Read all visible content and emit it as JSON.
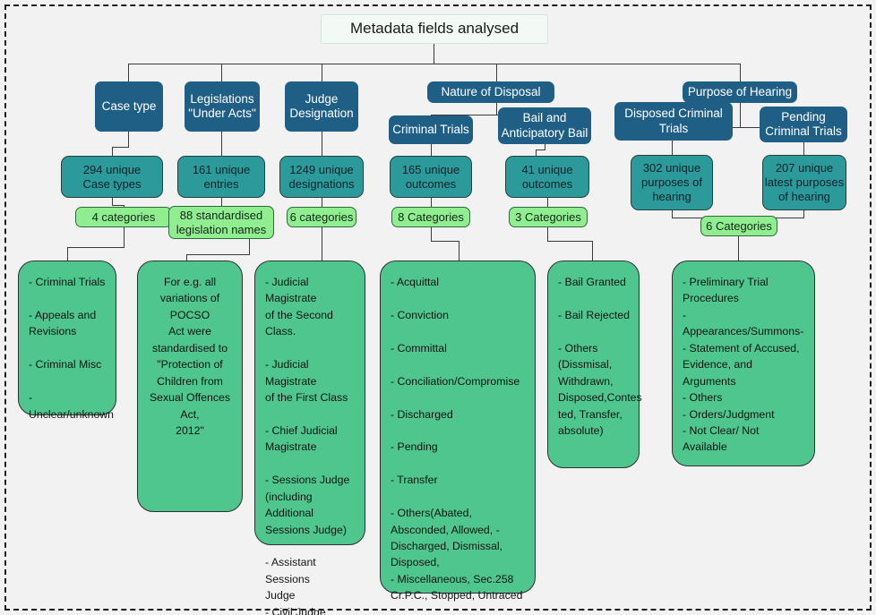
{
  "root": {
    "label": "Metadata fields analysed"
  },
  "colors": {
    "background": "#f2f2f2",
    "level1": "#1f5f86",
    "level2": "#2c9a9a",
    "category": "#90ee90",
    "leaf": "#4ec68e",
    "root_fill": "#f3faf5",
    "connector": "#3a3a3a",
    "frame": "#1c1c1c"
  },
  "branches": [
    {
      "id": "case-type",
      "title": "Case type",
      "count": "294 unique\nCase types",
      "categories": "4 categories",
      "detail": "- Criminal Trials\n\n- Appeals and\nRevisions\n\n- Criminal Misc\n\n- Unclear/unknown"
    },
    {
      "id": "legislations",
      "title": "Legislations\n\"Under Acts\"",
      "count": "161 unique\nentries",
      "categories": "88 standardised\nlegislation names",
      "detail": "For e.g. all\nvariations of POCSO\nAct were\nstandardised to\n\"Protection of\nChildren from\nSexual Offences Act,\n2012\""
    },
    {
      "id": "judge-designation",
      "title": "Judge\nDesignation",
      "count": "1249 unique\ndesignations",
      "categories": "6 categories",
      "detail": "- Judicial Magistrate\nof the Second Class.\n\n- Judicial Magistrate\nof the First Class\n\n- Chief Judicial\nMagistrate\n\n- Sessions Judge\n(including Additional\nSessions Judge)\n\n- Assistant Sessions\nJudge\n- Civil Judge"
    },
    {
      "id": "nature-of-disposal",
      "title": "Nature of Disposal",
      "children": [
        {
          "id": "criminal-trials",
          "title": "Criminal Trials",
          "count": "165 unique\noutcomes",
          "categories": "8 Categories",
          "detail": "- Acquittal\n\n- Conviction\n\n- Committal\n\n- Conciliation/Compromise\n\n- Discharged\n\n- Pending\n\n- Transfer\n\n- Others(Abated,\nAbsconded, Allowed,  -\nDischarged, Dismissal,\nDisposed,\n- Miscellaneous, Sec.258\nCr.P.C., Stopped, Untraced"
        },
        {
          "id": "bail-and-anticipatory-bail",
          "title": "Bail and\nAnticipatory Bail",
          "count": "41 unique\noutcomes",
          "categories": "3 Categories",
          "detail": "- Bail Granted\n\n- Bail Rejected\n\n- Others\n(Dissmisal,\nWithdrawn,\nDisposed,Contes\nted, Transfer,\nabsolute)"
        }
      ]
    },
    {
      "id": "purpose-of-hearing",
      "title": "Purpose of Hearing",
      "children": [
        {
          "id": "disposed-criminal-trials",
          "title": "Disposed Criminal\nTrials",
          "count": "302 unique\npurposes of\nhearing"
        },
        {
          "id": "pending-criminal-trials",
          "title": "Pending\nCriminal Trials",
          "count": "207 unique\nlatest purposes\nof hearing"
        }
      ],
      "categories": "6 Categories",
      "detail": "- Preliminary Trial\nProcedures\n-Appearances/Summons-\n- Statement of Accused,\nEvidence, and Arguments\n- Others\n- Orders/Judgment\n- Not Clear/ Not Available"
    }
  ]
}
